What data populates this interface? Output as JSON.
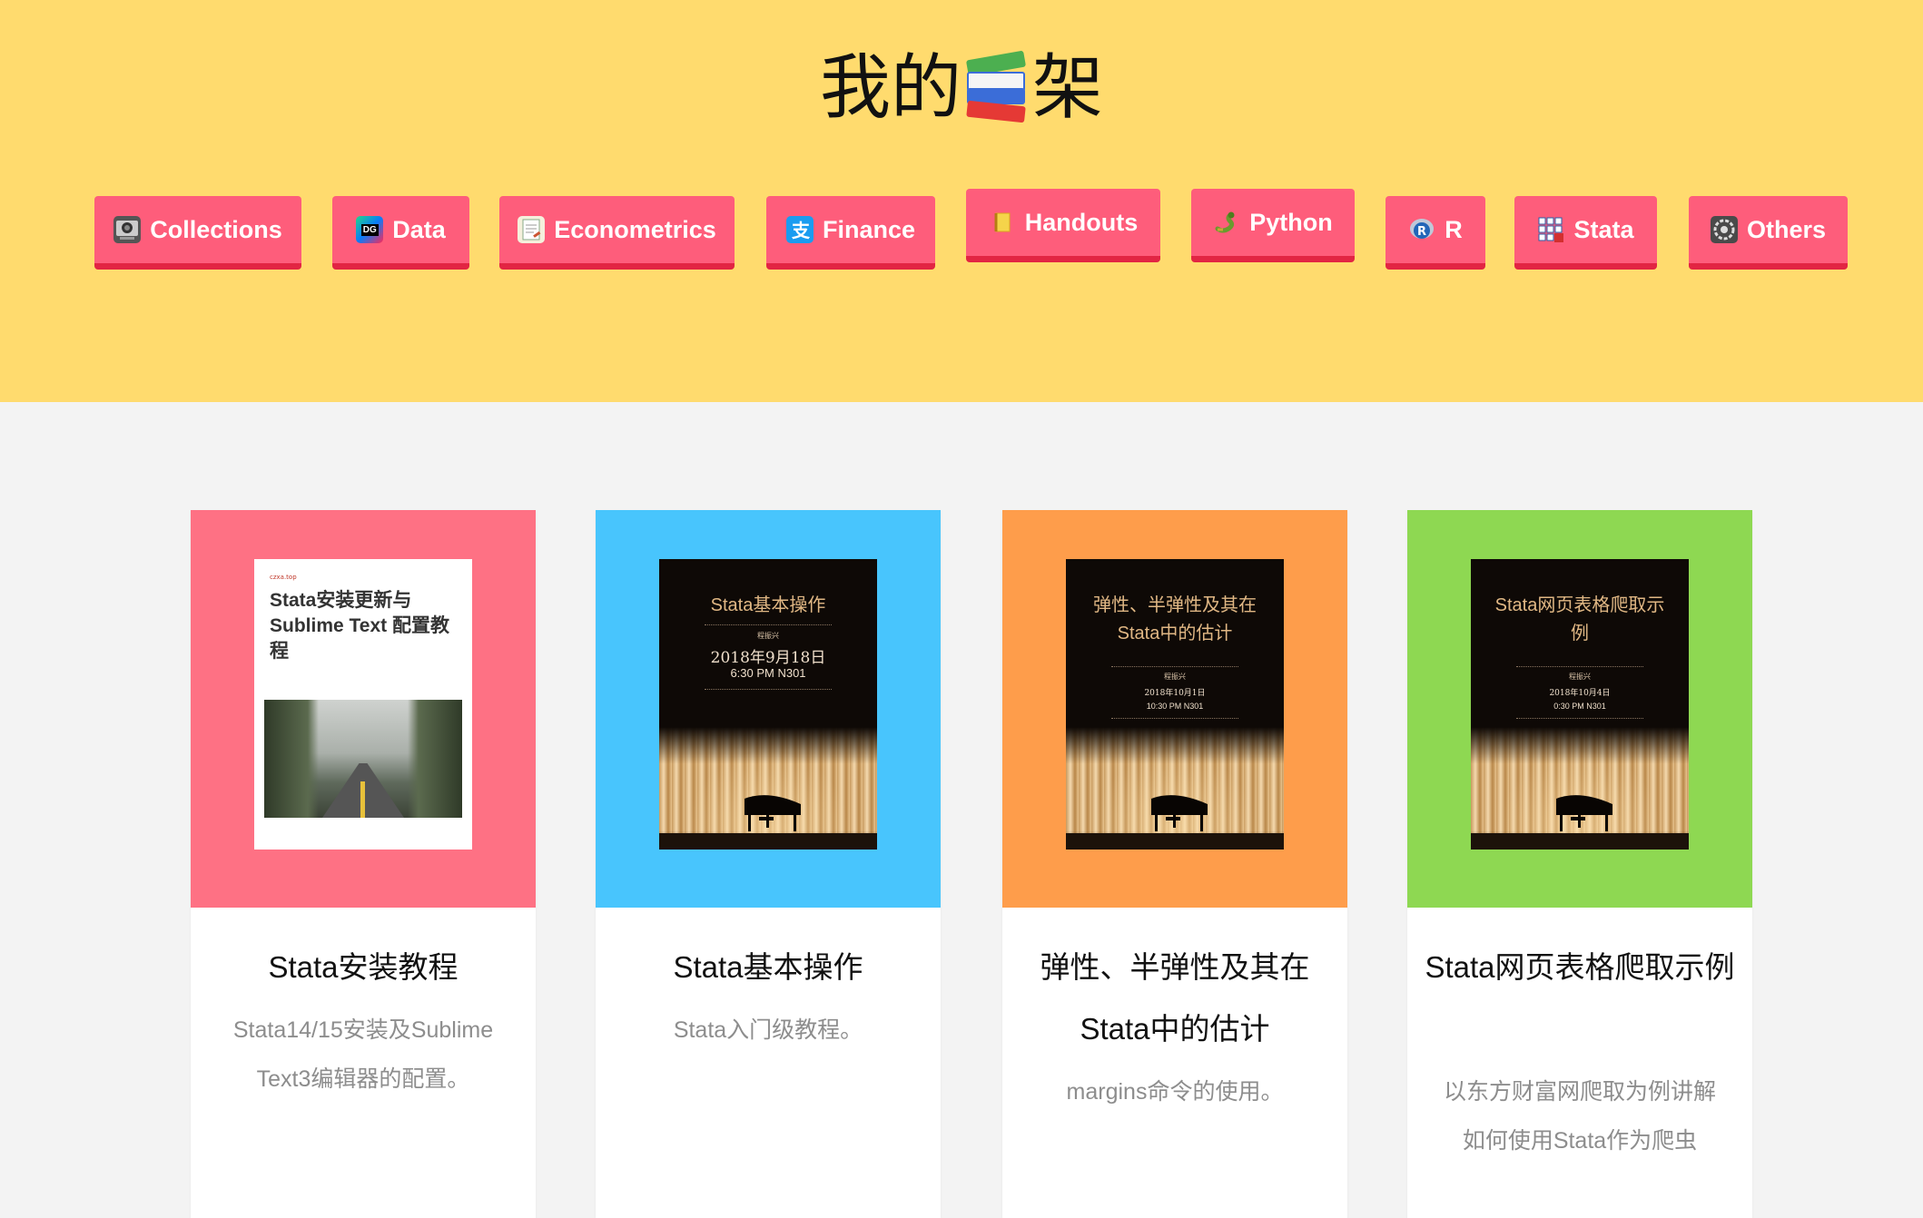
{
  "header": {
    "title_left": "我的",
    "title_right": "架",
    "books_icon": "books-emoji-icon",
    "background_color": "#ffdb6e"
  },
  "nav": {
    "button_color": "#fe5d7b",
    "items": [
      {
        "label": "Collections",
        "icon": "collections-icon"
      },
      {
        "label": "Data",
        "icon": "datagrip-icon"
      },
      {
        "label": "Econometrics",
        "icon": "notepad-icon"
      },
      {
        "label": "Finance",
        "icon": "alipay-icon"
      },
      {
        "label": "Handouts",
        "icon": "notebook-icon"
      },
      {
        "label": "Python",
        "icon": "snake-icon"
      },
      {
        "label": "R",
        "icon": "r-logo-icon"
      },
      {
        "label": "Stata",
        "icon": "stata-icon"
      },
      {
        "label": "Others",
        "icon": "settings-icon"
      }
    ]
  },
  "cards": [
    {
      "color": "#fe7184",
      "cover_small": "czxa.top",
      "cover_title": "Stata安装更新与 Sublime Text 配置教程",
      "title": "Stata安装教程",
      "desc": "Stata14/15安装及Sublime Text3编辑器的配置。"
    },
    {
      "color": "#48c5fd",
      "cover_title": "Stata基本操作",
      "cover_author": "程振兴",
      "cover_date": "2018年9月18日",
      "cover_time": "6:30 PM N301",
      "title": "Stata基本操作",
      "desc": "Stata入门级教程。"
    },
    {
      "color": "#fe9d4b",
      "cover_title": "弹性、半弹性及其在Stata中的估计",
      "cover_author": "程振兴",
      "cover_date": "2018年10月1日",
      "cover_time": "10:30 PM N301",
      "title": "弹性、半弹性及其在Stata中的估计",
      "desc": "margins命令的使用。"
    },
    {
      "color": "#8ed852",
      "cover_title": "Stata网页表格爬取示例",
      "cover_author": "程振兴",
      "cover_date": "2018年10月4日",
      "cover_time": "0:30 PM N301",
      "title": "Stata网页表格爬取示例",
      "desc": "以东方财富网爬取为例讲解如何使用Stata作为爬虫"
    }
  ]
}
